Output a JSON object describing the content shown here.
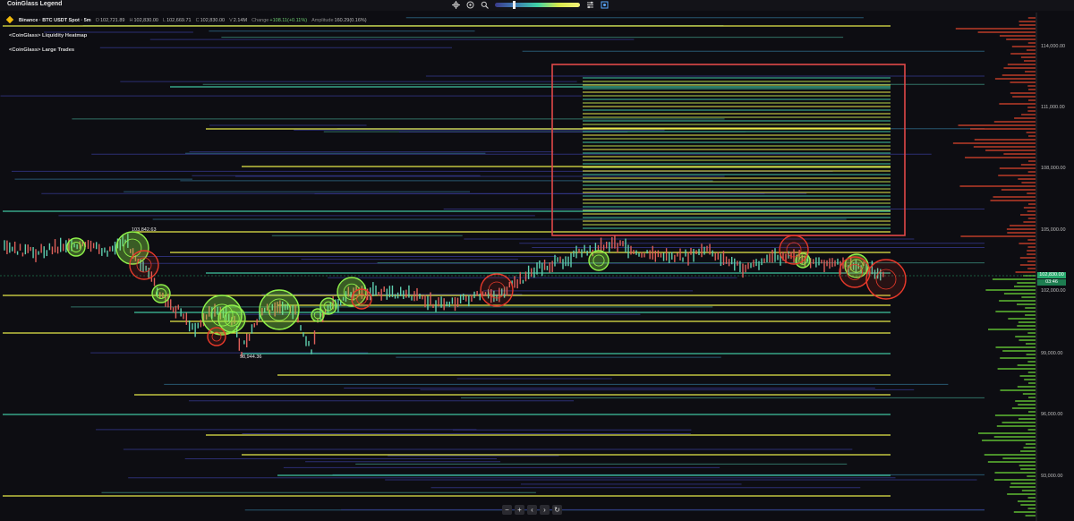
{
  "legend_title": "CoinGlass Legend",
  "toolbar": {
    "icons": [
      "crosshair-icon",
      "magnet-icon",
      "search-icon",
      "heatmap-gradient-slider",
      "settings-icon",
      "screenshot-icon"
    ]
  },
  "ohlc": {
    "symbol": "Binance · BTC USDT Spot · 5m",
    "open_label": "O",
    "open": "102,721.89",
    "high_label": "H",
    "high": "102,830.00",
    "low_label": "L",
    "low": "102,669.71",
    "close_label": "C",
    "close": "102,830.00",
    "volume_label": "V",
    "volume": "2.14M",
    "change_label": "Change",
    "change": "+108.11(+0.11%)",
    "amplitude_label": "Amplitude",
    "amplitude": "160.29(0.16%)"
  },
  "indicators": [
    "<CoinGlass> Liquidity Heatmap",
    "<CoinGlass> Large Trades"
  ],
  "price_axis": {
    "labels": [
      "114,000.00",
      "111,000.00",
      "108,000.00",
      "105,000.00",
      "102,000.00",
      "99,000.00",
      "96,000.00",
      "93,000.00"
    ],
    "current_price": "102,830.00",
    "countdown": "03:46"
  },
  "annotations": {
    "high_marker": "103,842.63",
    "low_marker": "98,944.36"
  },
  "nav_buttons": [
    "−",
    "+",
    "‹",
    "›",
    "↻"
  ],
  "colors": {
    "background": "#0d0d12",
    "bull_circle": "#8ff24a",
    "bear_circle": "#e8392a",
    "highlight_box": "#e04848",
    "heat_yellow": "#e6e84a",
    "heat_teal": "#3fc4a0",
    "heat_blue": "#34378a"
  }
}
